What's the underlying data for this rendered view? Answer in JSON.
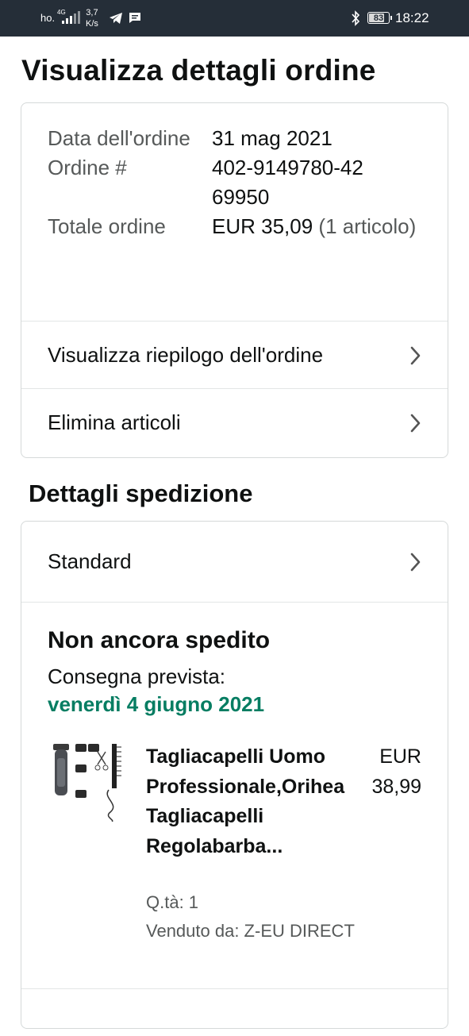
{
  "status_bar": {
    "carrier": "ho.",
    "network": "4G",
    "speed_value": "3,7",
    "speed_unit": "K/s",
    "battery": "83",
    "time": "18:22",
    "icons": [
      "signal-icon",
      "telegram-icon",
      "message-icon",
      "bluetooth-icon",
      "battery-icon"
    ]
  },
  "page": {
    "title": "Visualizza dettagli ordine"
  },
  "order": {
    "date_label": "Data dell'ordine",
    "date_value": "31 mag 2021",
    "number_label": "Ordine #",
    "number_value": "402-9149780-4269950",
    "total_label": "Totale ordine",
    "total_value": "EUR 35,09",
    "total_items": "(1 articolo)"
  },
  "links": {
    "summary": "Visualizza riepilogo dell'ordine",
    "delete_items": "Elimina articoli"
  },
  "shipping": {
    "section_title": "Dettagli spedizione",
    "method": "Standard",
    "status": "Non ancora spedito",
    "expected_label": "Consegna prevista:",
    "expected_date": "venerdì 4 giugno 2021",
    "accent_color": "#067d62"
  },
  "product": {
    "title": "Tagliacapelli Uomo Professionale,Orihea Tagliacapelli Regolabarba...",
    "price_currency": "EUR",
    "price_value": "38,99",
    "qty": "Q.tà: 1",
    "seller": "Venduto da: Z-EU DIRECT",
    "image_icon": "hair-clipper-image"
  }
}
